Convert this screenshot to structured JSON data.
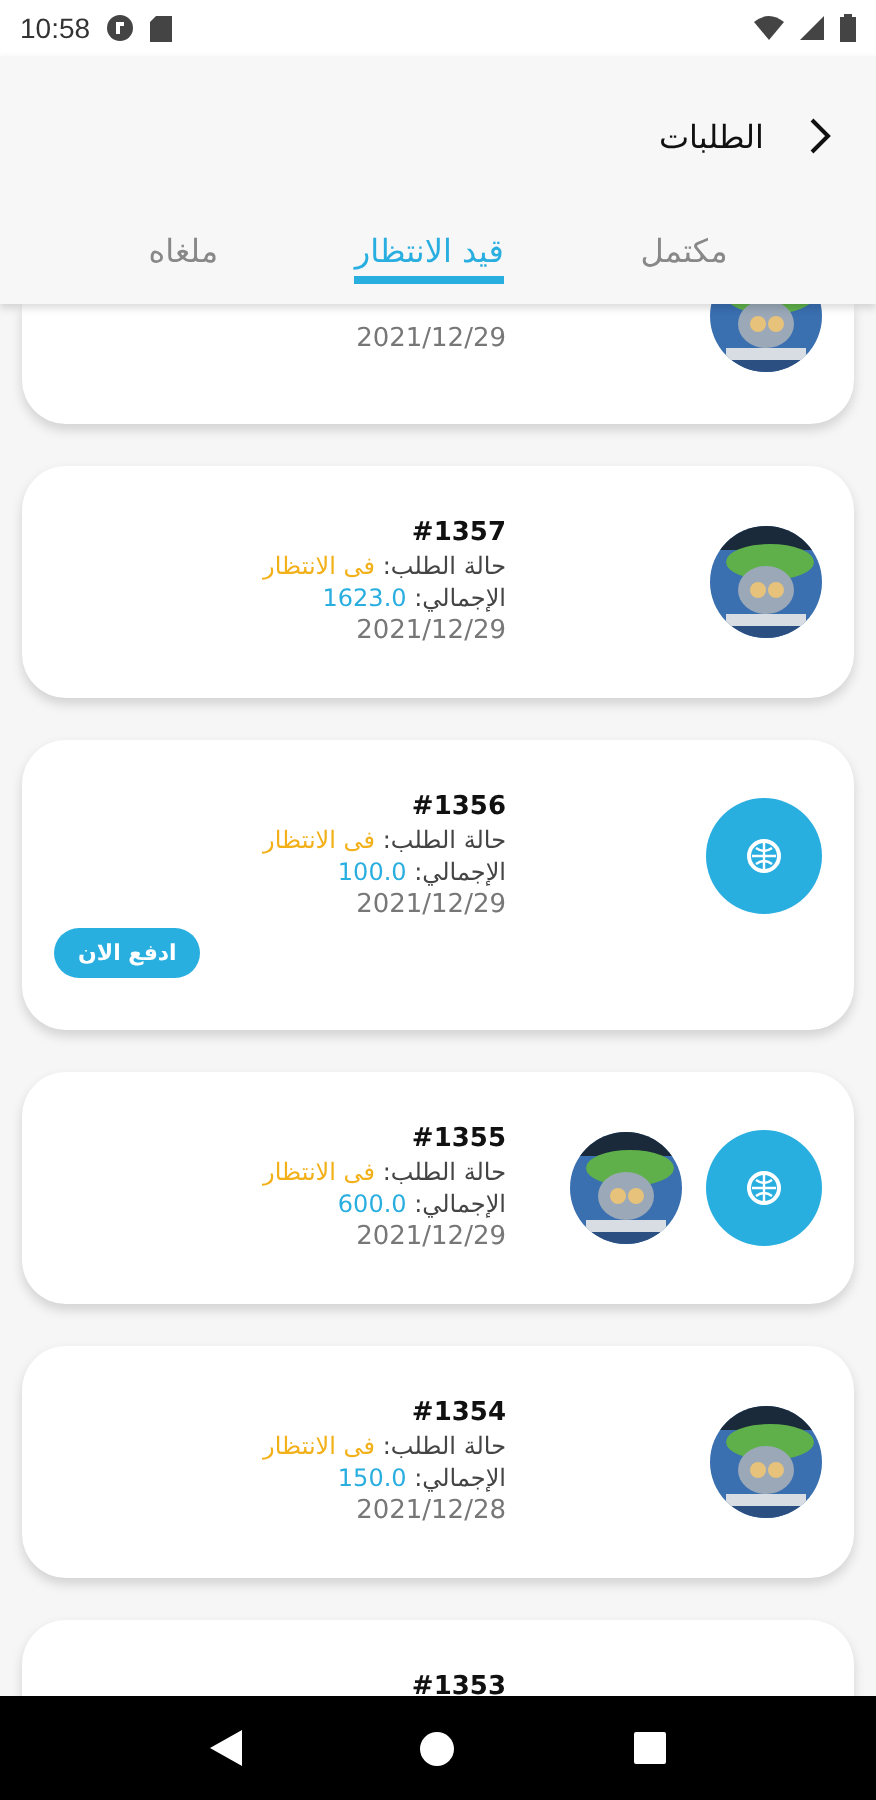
{
  "status_bar": {
    "time": "10:58"
  },
  "header": {
    "title": "الطلبات"
  },
  "tabs": [
    {
      "label": "مكتمل",
      "selected": false
    },
    {
      "label": "قيد الانتظار",
      "selected": true
    },
    {
      "label": "ملغاه",
      "selected": false
    }
  ],
  "orders": [
    {
      "kind": "partial",
      "date": "2021/12/29",
      "thumbs": [
        {
          "kind": "picture"
        }
      ]
    },
    {
      "kind": "full",
      "number": "#1357",
      "status_label": "حالة الطلب:",
      "status": "فى الانتظار",
      "total_label": "الإجمالي:",
      "total": "1623.0",
      "date": "2021/12/29",
      "thumbs": [
        {
          "kind": "picture"
        }
      ]
    },
    {
      "kind": "full",
      "number": "#1356",
      "status_label": "حالة الطلب:",
      "status": "فى الانتظار",
      "total_label": "الإجمالي:",
      "total": "100.0",
      "date": "2021/12/29",
      "thumbs": [
        {
          "kind": "logo"
        }
      ],
      "pay_button": "ادفع الان"
    },
    {
      "kind": "full",
      "number": "#1355",
      "status_label": "حالة الطلب:",
      "status": "فى الانتظار",
      "total_label": "الإجمالي:",
      "total": "600.0",
      "date": "2021/12/29",
      "thumbs": [
        {
          "kind": "logo"
        },
        {
          "kind": "picture"
        }
      ]
    },
    {
      "kind": "full",
      "number": "#1354",
      "status_label": "حالة الطلب:",
      "status": "فى الانتظار",
      "total_label": "الإجمالي:",
      "total": "150.0",
      "date": "2021/12/28",
      "thumbs": [
        {
          "kind": "picture"
        }
      ]
    },
    {
      "kind": "cut",
      "number": "#1353"
    }
  ]
}
